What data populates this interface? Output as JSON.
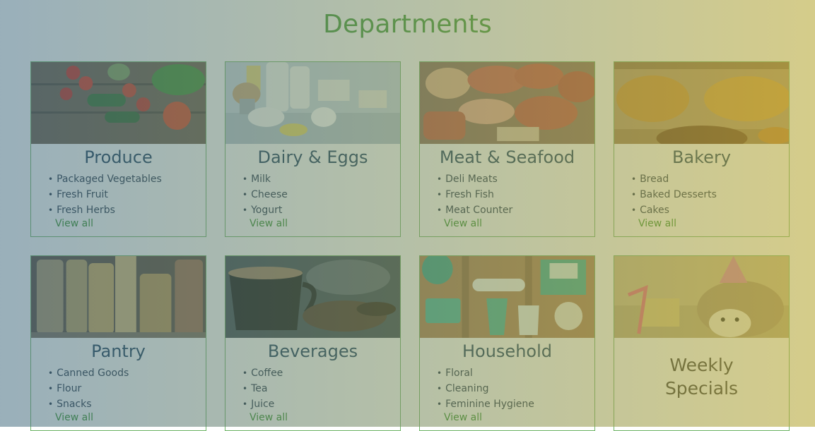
{
  "page": {
    "title": "Departments"
  },
  "departments": [
    {
      "name": "Produce",
      "items": [
        "Packaged Vegetables",
        "Fresh Fruit",
        "Fresh Herbs"
      ],
      "link": "View all",
      "image": "vegetables-photo"
    },
    {
      "name": "Dairy & Eggs",
      "items": [
        "Milk",
        "Cheese",
        "Yogurt"
      ],
      "link": "View all",
      "image": "dairy-photo"
    },
    {
      "name": "Meat & Seafood",
      "items": [
        "Deli Meats",
        "Fresh Fish",
        "Meat Counter"
      ],
      "link": "View all",
      "image": "meat-photo"
    },
    {
      "name": "Bakery",
      "items": [
        "Bread",
        "Baked Desserts",
        "Cakes"
      ],
      "link": "View all",
      "image": "bread-photo"
    },
    {
      "name": "Pantry",
      "items": [
        "Canned Goods",
        "Flour",
        "Snacks"
      ],
      "link": "View all",
      "image": "pasta-jars-photo"
    },
    {
      "name": "Beverages",
      "items": [
        "Coffee",
        "Tea",
        "Juice"
      ],
      "link": "View all",
      "image": "coffee-photo"
    },
    {
      "name": "Household",
      "items": [
        "Floral",
        "Cleaning",
        "Feminine Hygiene"
      ],
      "link": "View all",
      "image": "cleaning-supplies-photo"
    }
  ],
  "special": {
    "line1": "Weekly",
    "line2": "Specials",
    "image": "hedgehog-party-photo"
  },
  "colors": {
    "title": "#3f9a35",
    "link": "#2f8d29",
    "border": "#6fb567",
    "heading": "#163a5a"
  }
}
